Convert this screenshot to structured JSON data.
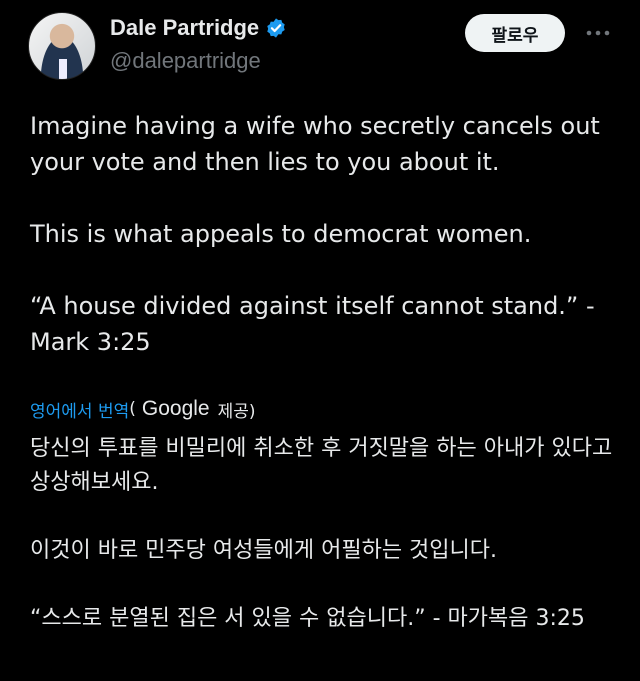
{
  "author": {
    "display_name": "Dale Partridge",
    "handle": "@dalepartridge"
  },
  "actions": {
    "follow_label": "팔로우",
    "more_label": "···"
  },
  "tweet": {
    "paragraphs": [
      "Imagine having a wife who secretly cancels out your vote and then lies to you about it.",
      "This is what appeals to democrat women.",
      "“A house divided against itself cannot stand.” - Mark 3:25"
    ]
  },
  "translation": {
    "link_label": "영어에서 번역",
    "open_paren": "(",
    "provider": "Google",
    "provided_label": "제공)",
    "paragraphs": [
      "당신의 투표를 비밀리에 취소한 후 거짓말을 하는 아내가 있다고 상상해보세요.",
      "이것이 바로 민주당 여성들에게 어필하는 것입니다.",
      "“스스로 분열된 집은 서 있을 수 없습니다.” - 마가복음 3:25"
    ]
  },
  "colors": {
    "background": "#000000",
    "text": "#e7e9ea",
    "secondary": "#71767b",
    "link": "#1d9bf0",
    "verified": "#1d9bf0"
  }
}
